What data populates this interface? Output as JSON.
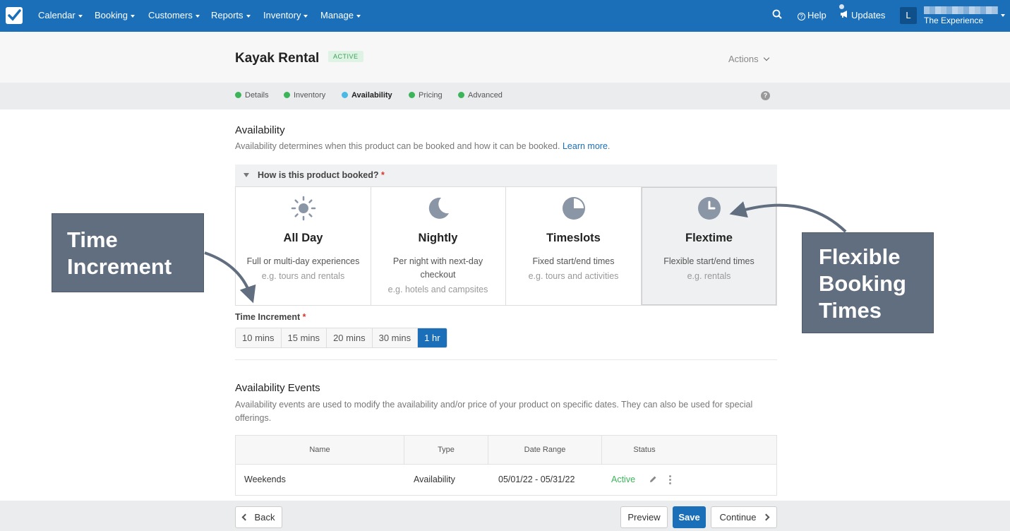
{
  "nav": {
    "items": [
      "Calendar",
      "Booking",
      "Customers",
      "Reports",
      "Inventory",
      "Manage"
    ],
    "help": "Help",
    "updates": "Updates",
    "avatar_initial": "L",
    "account_name": "The Experience"
  },
  "header": {
    "title": "Kayak Rental",
    "status": "ACTIVE",
    "actions": "Actions"
  },
  "steps": [
    "Details",
    "Inventory",
    "Availability",
    "Pricing",
    "Advanced"
  ],
  "current_step": "Availability",
  "availability": {
    "title": "Availability",
    "description": "Availability determines when this product can be booked and how it can be booked.",
    "learn_more": "Learn more",
    "question": "How is this product booked?",
    "required_mark": "*",
    "options": [
      {
        "icon": "sun-icon",
        "title": "All Day",
        "subtitle": "Full or multi-day experiences",
        "example": "e.g. tours and rentals"
      },
      {
        "icon": "moon-icon",
        "title": "Nightly",
        "subtitle": "Per night with next-day checkout",
        "example": "e.g. hotels and campsites"
      },
      {
        "icon": "pie-icon",
        "title": "Timeslots",
        "subtitle": "Fixed start/end times",
        "example": "e.g. tours and activities"
      },
      {
        "icon": "clock-icon",
        "title": "Flextime",
        "subtitle": "Flexible start/end times",
        "example": "e.g. rentals"
      }
    ],
    "selected_option": "Flextime",
    "time_increment_label": "Time Increment",
    "increments": [
      "10 mins",
      "15 mins",
      "20 mins",
      "30 mins",
      "1 hr"
    ],
    "selected_increment": "1 hr"
  },
  "events": {
    "title": "Availability Events",
    "description": "Availability events are used to modify the availability and/or price of your product on specific dates. They can also be used for special offerings.",
    "columns": [
      "Name",
      "Type",
      "Date Range",
      "Status"
    ],
    "rows": [
      {
        "name": "Weekends",
        "type": "Availability",
        "date_range": "05/01/22 - 05/31/22",
        "status": "Active"
      }
    ]
  },
  "footer": {
    "back": "Back",
    "preview": "Preview",
    "save": "Save",
    "continue": "Continue"
  },
  "annotations": {
    "left": [
      "Time",
      "Increment"
    ],
    "right": [
      "Flexible",
      "Booking",
      "Times"
    ]
  },
  "colors": {
    "nav_bg": "#1a6fb8",
    "active_green": "#3cb55a",
    "current_step": "#4ab9e6",
    "callout_bg": "#616e7f"
  }
}
